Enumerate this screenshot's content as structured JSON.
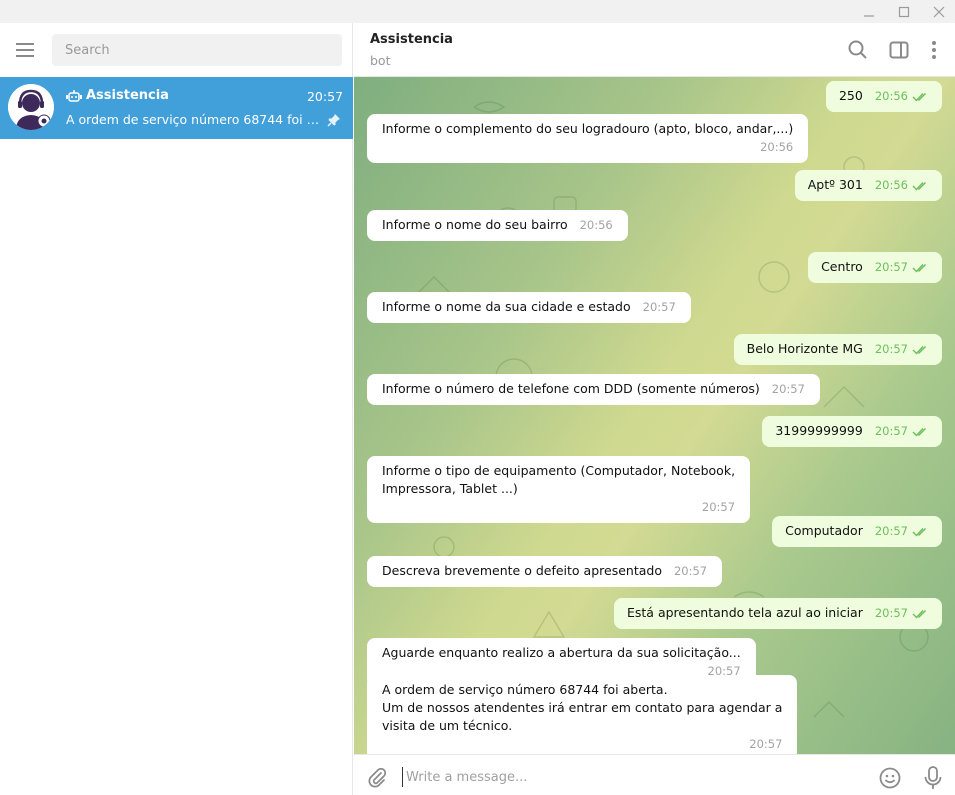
{
  "search": {
    "placeholder": "Search"
  },
  "chat_list": [
    {
      "name": "Assistencia",
      "time": "20:57",
      "preview": "A ordem de serviço número 68744 foi ab..."
    }
  ],
  "header": {
    "title": "Assistencia",
    "status": "bot"
  },
  "messages": [
    {
      "dir": "out",
      "text": "250",
      "time": "20:56"
    },
    {
      "dir": "in",
      "text": "Informe o complemento do seu logradouro (apto, bloco, andar,...)",
      "time": "20:56"
    },
    {
      "dir": "out",
      "text": "Aptº 301",
      "time": "20:56"
    },
    {
      "dir": "in",
      "text": "Informe o nome do seu bairro",
      "time": "20:56"
    },
    {
      "dir": "out",
      "text": "Centro",
      "time": "20:57"
    },
    {
      "dir": "in",
      "text": "Informe o nome da sua cidade e estado",
      "time": "20:57"
    },
    {
      "dir": "out",
      "text": "Belo Horizonte MG",
      "time": "20:57"
    },
    {
      "dir": "in",
      "text": "Informe o número de telefone com DDD (somente números)",
      "time": "20:57"
    },
    {
      "dir": "out",
      "text": "31999999999",
      "time": "20:57"
    },
    {
      "dir": "in",
      "text": "Informe o tipo de equipamento (Computador, Notebook,\nImpressora, Tablet ...)",
      "time": "20:57"
    },
    {
      "dir": "out",
      "text": "Computador",
      "time": "20:57"
    },
    {
      "dir": "in",
      "text": "Descreva brevemente o defeito apresentado",
      "time": "20:57"
    },
    {
      "dir": "out",
      "text": "Está apresentando tela azul ao iniciar",
      "time": "20:57"
    },
    {
      "dir": "in",
      "text": "Aguarde enquanto realizo a abertura da sua solicitação...",
      "time": "20:57"
    },
    {
      "dir": "in",
      "text": "A ordem de serviço número 68744 foi aberta.\nUm de nossos atendentes irá entrar em contato para agendar a\nvisita de um técnico.",
      "time": "20:57"
    }
  ],
  "composer": {
    "placeholder": "Write a message..."
  },
  "colors": {
    "accent": "#419fd9",
    "outgoing_bubble": "#effdde",
    "read_check": "#6cbf5b"
  },
  "icons": [
    "minimize-icon",
    "maximize-icon",
    "close-icon",
    "menu-icon",
    "bot-icon",
    "pin-icon",
    "search-icon",
    "sidebar-toggle-icon",
    "more-icon",
    "attach-icon",
    "emoji-icon",
    "microphone-icon"
  ]
}
